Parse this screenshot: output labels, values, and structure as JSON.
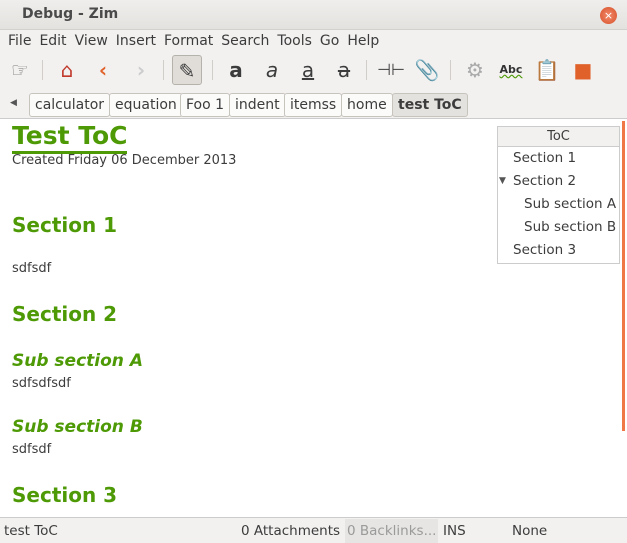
{
  "window": {
    "title": "Debug - Zim",
    "close": "×"
  },
  "menu": [
    "File",
    "Edit",
    "View",
    "Insert",
    "Format",
    "Search",
    "Tools",
    "Go",
    "Help"
  ],
  "pathbar": {
    "items": [
      "calculator",
      "equation",
      "Foo 1",
      "indent",
      "itemss",
      "home",
      "test ToC"
    ],
    "current": "test ToC"
  },
  "page": {
    "title": "Test ToC",
    "created": "Created Friday 06 December 2013",
    "blocks": [
      {
        "type": "h2",
        "text": "Section 1"
      },
      {
        "type": "p",
        "text": "sdfsdf"
      },
      {
        "type": "h2",
        "text": "Section 2"
      },
      {
        "type": "h3",
        "text": "Sub section A"
      },
      {
        "type": "p",
        "text": "sdfsdfsdf"
      },
      {
        "type": "h3",
        "text": "Sub section B"
      },
      {
        "type": "p",
        "text": "sdfsdf"
      },
      {
        "type": "h2",
        "text": "Section 3"
      }
    ]
  },
  "toc": {
    "header": "ToC",
    "items": [
      "Section 1",
      "Section 2",
      "Sub section A",
      "Sub section B",
      "Section 3"
    ],
    "expander": "▼"
  },
  "status": {
    "page": "test ToC",
    "attachments": "0 Attachments",
    "backlinks": "0 Backlinks...",
    "mode": "INS",
    "style": "None"
  },
  "colors": {
    "heading": "#4e9a06",
    "scrollbar": "#f07746"
  }
}
